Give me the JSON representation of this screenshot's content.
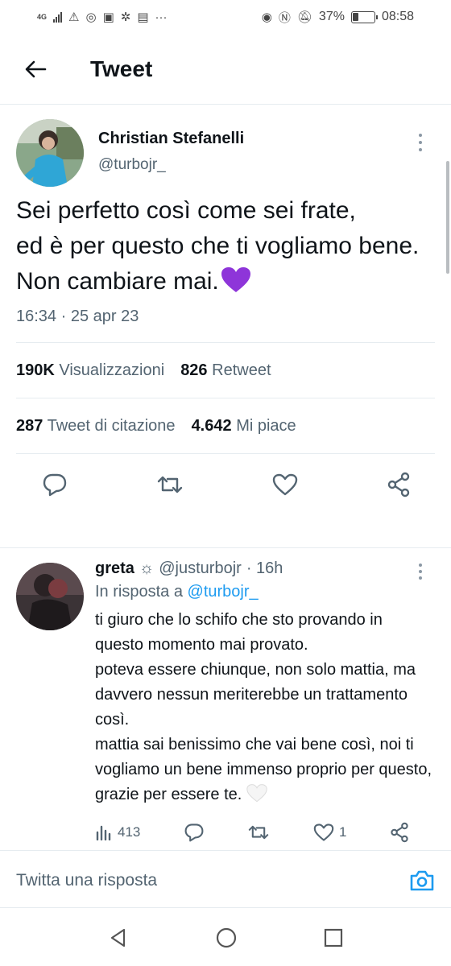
{
  "status_bar": {
    "network": "4G",
    "battery": "37%",
    "battery_level": 0.37,
    "time": "08:58"
  },
  "header": {
    "title": "Tweet"
  },
  "tweet": {
    "author_name": "Christian Stefanelli",
    "author_handle": "@turbojr_",
    "text": "Sei perfetto così come sei frate,\ned è per questo che ti vogliamo bene.\nNon cambiare mai.",
    "emoji": "purple-heart",
    "timestamp": "16:34 · 25 apr 23",
    "views_count": "190K",
    "views_label": "Visualizzazioni",
    "retweets_count": "826",
    "retweets_label": "Retweet",
    "quotes_count": "287",
    "quotes_label": "Tweet di citazione",
    "likes_count": "4.642",
    "likes_label": "Mi piace"
  },
  "reply": {
    "name": "greta",
    "name_symbol": "☼",
    "handle": "@justurbojr",
    "time": "· 16h",
    "replying_to_prefix": "In risposta a",
    "replying_to_handle": "@turbojr_",
    "text": "ti giuro che lo schifo che sto provando in questo momento mai provato.\npoteva essere chiunque, non solo mattia, ma davvero nessun meriterebbe un trattamento così.\nmattia sai benissimo che vai bene così, noi ti vogliamo un bene immenso proprio per questo, grazie per essere te.",
    "emoji": "white-heart",
    "views": "413",
    "likes": "1"
  },
  "composer": {
    "placeholder": "Twitta una risposta"
  },
  "colors": {
    "accent": "#1d9bf0",
    "text": "#0f1419",
    "secondary": "#536471",
    "purple_heart": "#8e35d9"
  }
}
